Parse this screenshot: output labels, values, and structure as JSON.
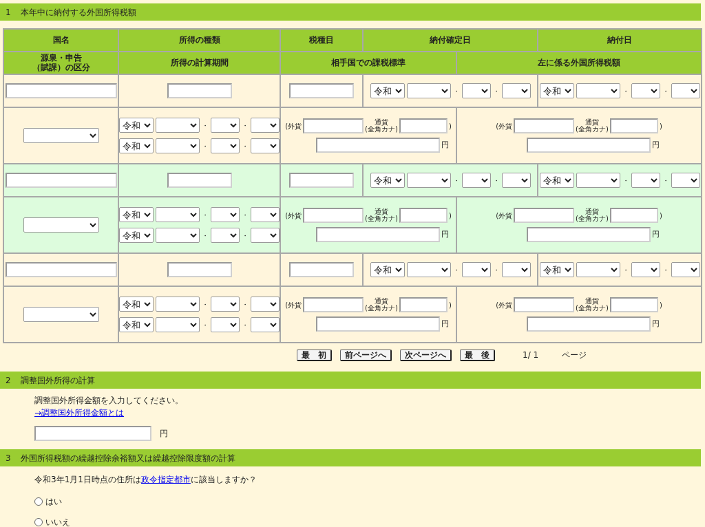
{
  "section1": {
    "number": "1",
    "title": "本年中に納付する外国所得税額",
    "header_row1": [
      "国名",
      "所得の種類",
      "税種目",
      "納付確定日",
      "納付日"
    ],
    "header_row2_lines": [
      "源泉・申告",
      "（賦課）の区分"
    ],
    "header_row2": [
      "所得の計算期間",
      "相手国での課税標準",
      "左に係る外国所得税額"
    ],
    "records": [
      {
        "color": "#fff5dc",
        "payment_fixed_date": {
          "era": "令和",
          "sep1": "・",
          "sep2": "・"
        },
        "payment_date": {
          "era": "令和",
          "sep1": "・",
          "sep2": "・"
        },
        "period": [
          {
            "era": "令和",
            "sep1": "・",
            "sep2": "・"
          },
          {
            "era": "令和",
            "sep1": "・",
            "sep2": "・"
          }
        ],
        "tax_base": {
          "foreign": "(外貨",
          "currency": "通貨",
          "currency_note": "(全角カナ)",
          "close": ")",
          "unit": "円"
        },
        "foreign_tax": {
          "foreign": "(外貨",
          "currency": "通貨",
          "currency_note": "(全角カナ)",
          "close": ")",
          "unit": "円"
        }
      },
      {
        "color": "#ddfcdd",
        "payment_fixed_date": {
          "era": "令和",
          "sep1": "・",
          "sep2": "・"
        },
        "payment_date": {
          "era": "令和",
          "sep1": "・",
          "sep2": "・"
        },
        "period": [
          {
            "era": "令和",
            "sep1": "・",
            "sep2": "・"
          },
          {
            "era": "令和",
            "sep1": "・",
            "sep2": "・"
          }
        ],
        "tax_base": {
          "foreign": "(外貨",
          "currency": "通貨",
          "currency_note": "(全角カナ)",
          "close": ")",
          "unit": "円"
        },
        "foreign_tax": {
          "foreign": "(外貨",
          "currency": "通貨",
          "currency_note": "(全角カナ)",
          "close": ")",
          "unit": "円"
        }
      },
      {
        "color": "#fff5dc",
        "payment_fixed_date": {
          "era": "令和",
          "sep1": "・",
          "sep2": "・"
        },
        "payment_date": {
          "era": "令和",
          "sep1": "・",
          "sep2": "・"
        },
        "period": [
          {
            "era": "令和",
            "sep1": "・",
            "sep2": "・"
          },
          {
            "era": "令和",
            "sep1": "・",
            "sep2": "・"
          }
        ],
        "tax_base": {
          "foreign": "(外貨",
          "currency": "通貨",
          "currency_note": "(全角カナ)",
          "close": ")",
          "unit": "円"
        },
        "foreign_tax": {
          "foreign": "(外貨",
          "currency": "通貨",
          "currency_note": "(全角カナ)",
          "close": ")",
          "unit": "円"
        }
      }
    ],
    "pager": {
      "buttons": [
        "最　初",
        "前ページへ",
        "次ページへ",
        "最　後"
      ],
      "page": "1/ 1",
      "page_label": "ページ"
    }
  },
  "section2": {
    "number": "2",
    "title": "調整国外所得の計算",
    "instruction": "調整国外所得金額を入力してください。",
    "link": "→調整国外所得金額とは",
    "unit": "円"
  },
  "section3": {
    "number": "3",
    "title": "外国所得税額の繰越控除余裕額又は繰越控除限度額の計算",
    "question": {
      "before": "令和3年1月1日時点の住所は",
      "link": "政令指定都市",
      "after": "に該当しますか？"
    },
    "radios": [
      {
        "label": "はい",
        "selected": false
      },
      {
        "label": "いいえ",
        "selected": false
      }
    ]
  }
}
